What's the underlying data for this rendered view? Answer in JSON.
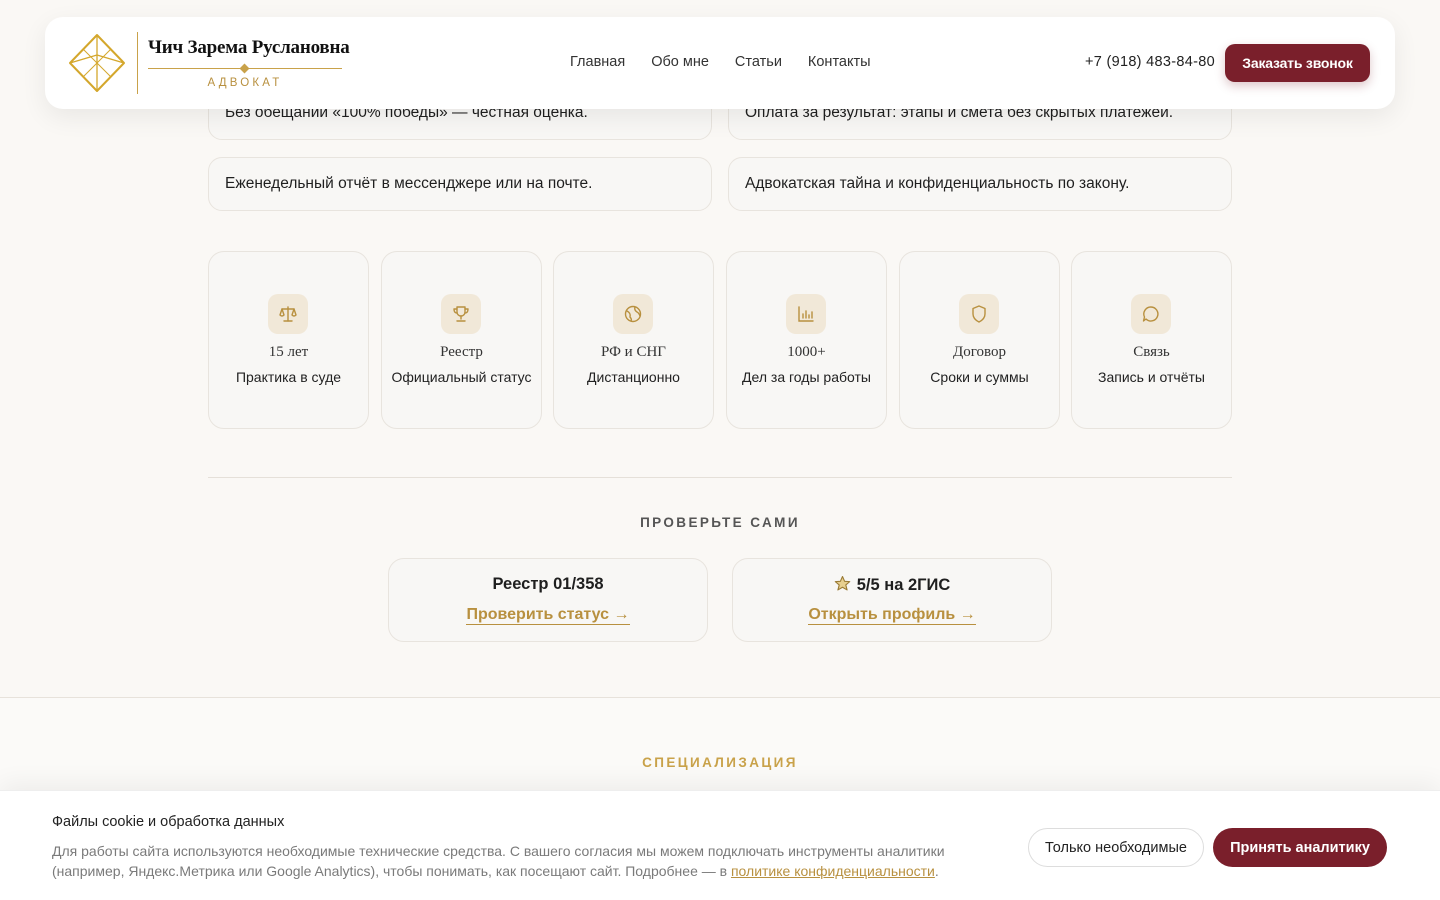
{
  "header": {
    "brand_name": "Чич Зарема Руслановна",
    "brand_sub": "АДВОКАТ",
    "nav": [
      "Главная",
      "Обо мне",
      "Статьи",
      "Контакты"
    ],
    "phone": "+7 (918) 483-84-80",
    "cta": "Заказать звонок"
  },
  "pills": [
    "Без обещаний «100% победы» — честная оценка.",
    "Оплата за результат: этапы и смета без скрытых платежей.",
    "Еженедельный отчёт в мессенджере или на почте.",
    "Адвокатская тайна и конфиденциальность по закону."
  ],
  "stats": [
    {
      "icon": "scales-icon",
      "title": "15 лет",
      "sub": "Практика в суде"
    },
    {
      "icon": "trophy-icon",
      "title": "Реестр",
      "sub": "Официальный статус"
    },
    {
      "icon": "globe-icon",
      "title": "РФ и СНГ",
      "sub": "Дистанционно"
    },
    {
      "icon": "chart-icon",
      "title": "1000+",
      "sub": "Дел за годы работы"
    },
    {
      "icon": "shield-icon",
      "title": "Договор",
      "sub": "Сроки и суммы"
    },
    {
      "icon": "chat-icon",
      "title": "Связь",
      "sub": "Запись и отчёты"
    }
  ],
  "check": {
    "heading": "ПРОВЕРЬТЕ САМИ",
    "registry_title": "Реестр 01/358",
    "registry_link": "Проверить статус →",
    "rating_title": "5/5 на 2ГИС",
    "rating_link": "Открыть профиль →"
  },
  "specialization": {
    "label": "СПЕЦИАЛИЗАЦИЯ",
    "title": ""
  },
  "cookie": {
    "title": "Файлы cookie и обработка данных",
    "text": "Для работы сайта используются необходимые технические средства. С вашего согласия мы можем подключать инструменты аналитики (например, Яндекс.Метрика или Google Analytics), чтобы понимать, как посещают сайт. Подробнее — в ",
    "link": "политике конфиденциальности",
    "text_end": ".",
    "btn_necessary": "Только необходимые",
    "btn_accept": "Принять аналитику"
  },
  "colors": {
    "accent": "#7a1f2b",
    "gold": "#c9a24a",
    "background": "#faf8f5"
  }
}
